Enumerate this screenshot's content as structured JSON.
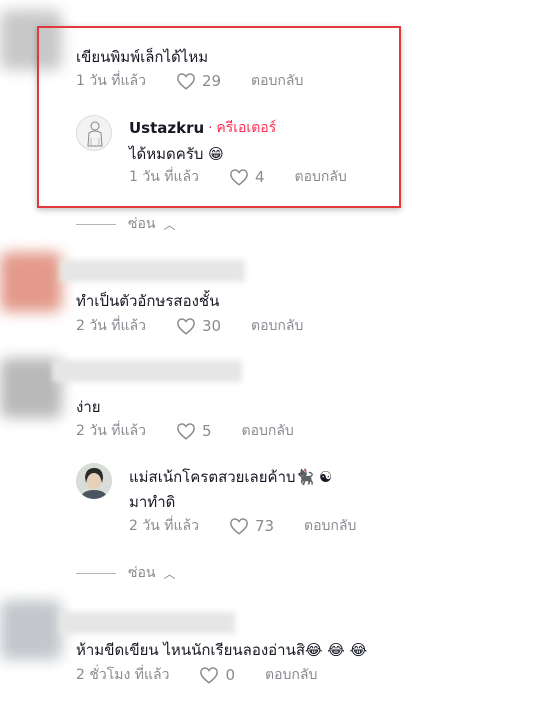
{
  "comments": [
    {
      "text": "เขียนพิมพ์เล็กได้ไหม",
      "time": "1 วัน ที่แล้ว",
      "likes": "29",
      "reply_label": "ตอบกลับ",
      "replies": [
        {
          "username": "Ustazkru",
          "badge_separator": "·",
          "badge": "ครีเอเตอร์",
          "text": "ได้หมดครับ 😁",
          "time": "1 วัน ที่แล้ว",
          "likes": "4",
          "reply_label": "ตอบกลับ"
        }
      ],
      "hide_label": "ซ่อน"
    },
    {
      "text": "ทำเป็นตัวอักษรสองชั้น",
      "time": "2 วัน ที่แล้ว",
      "likes": "30",
      "reply_label": "ตอบกลับ"
    },
    {
      "text": "ง่าย",
      "time": "2 วัน ที่แล้ว",
      "likes": "5",
      "reply_label": "ตอบกลับ",
      "replies": [
        {
          "text_line1": "แม่สเน้กโครตสวยเลยค้าบ🐈‍⬛ ☯",
          "text_line2": "มาทำดิ",
          "time": "2 วัน ที่แล้ว",
          "likes": "73",
          "reply_label": "ตอบกลับ"
        }
      ],
      "hide_label": "ซ่อน"
    },
    {
      "text": "ห้ามขีดเขียน ไหนนักเรียนลองอ่านสิ😂 😂 😂",
      "time": "2 ชั่วโมง ที่แล้ว",
      "likes": "0",
      "reply_label": "ตอบกลับ"
    }
  ],
  "colors": {
    "highlight_border": "#e0393e",
    "creator_badge": "#fe2c55",
    "meta_text": "#8a8b91"
  },
  "icons": [
    "heart-outline-icon",
    "chevron-up-icon"
  ]
}
